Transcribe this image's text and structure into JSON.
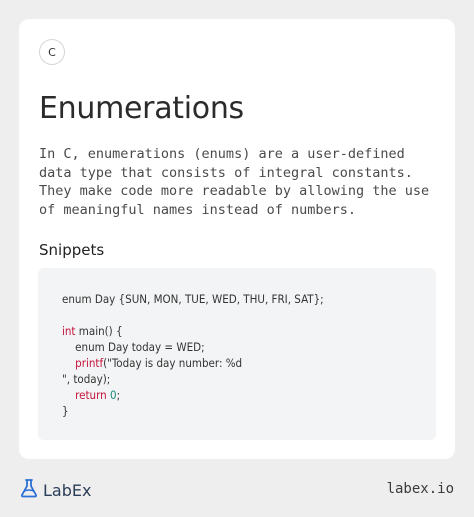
{
  "card": {
    "badge": "C",
    "title": "Enumerations",
    "description": "In C, enumerations (enums) are a user-defined data type that consists of integral constants. They make code more readable by allowing the use of meaningful names instead of numbers.",
    "snippets_heading": "Snippets"
  },
  "code": {
    "line1": "enum Day {SUN, MON, TUE, WED, THU, FRI, SAT};",
    "kw_int": "int",
    "main_sig": " main() {",
    "line_enum": "    enum Day today = WED;",
    "kw_printf": "printf",
    "printf_arg": "(\"Today is day number: %d",
    "printf_cont": "\", today);",
    "kw_return": "return",
    "num_zero": "0",
    "semicolon": ";",
    "close_brace": "}"
  },
  "footer": {
    "logo_text": "LabEx",
    "link": "labex.io"
  },
  "colors": {
    "keyword": "#c4143c",
    "number": "#1a8a7a",
    "logo": "#2b6fd6"
  },
  "icons": {
    "logo": "flask-icon"
  }
}
